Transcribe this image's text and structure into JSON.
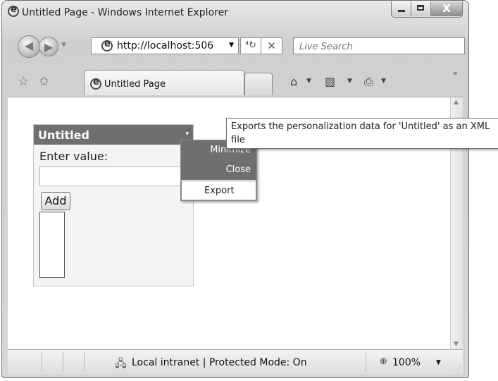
{
  "window": {
    "title": "Untitled Page - Windows Internet Explorer",
    "caption_close": "X"
  },
  "address": {
    "url": "http://localhost:506",
    "search_placeholder": "Live Search"
  },
  "tab": {
    "label": "Untitled Page"
  },
  "webpart": {
    "title": "Untitled",
    "verbs_arrow": "▾",
    "label": "Enter value:",
    "add_button": "Add"
  },
  "menu": {
    "items": [
      {
        "label": "Minimize"
      },
      {
        "label": "Close"
      },
      {
        "label": "Export"
      }
    ]
  },
  "tooltip": {
    "text": "Exports the personalization data for 'Untitled' as an XML file"
  },
  "status": {
    "zone": "Local intranet | Protected Mode: On",
    "zoom": "100%"
  },
  "icons": {
    "back": "back-arrow-icon",
    "forward": "forward-arrow-icon",
    "refresh": "refresh-icon",
    "stop": "stop-icon",
    "favorites": "favorites-star-icon",
    "add_favorites": "add-favorites-icon",
    "home": "home-icon",
    "feeds": "feeds-icon",
    "print": "print-icon",
    "zone": "intranet-zone-icon",
    "zoom": "zoom-icon"
  }
}
